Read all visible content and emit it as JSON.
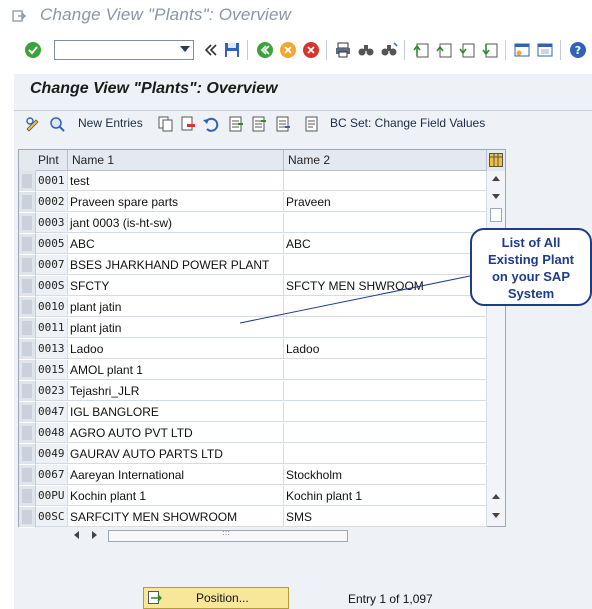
{
  "window": {
    "title": "Change View \"Plants\": Overview"
  },
  "screen": {
    "heading": "Change View \"Plants\": Overview"
  },
  "toolbar": {
    "new_entries": "New Entries",
    "bc_set": "BC Set: Change Field Values"
  },
  "table": {
    "headers": {
      "plnt": "Plnt",
      "name1": "Name 1",
      "name2": "Name 2"
    },
    "rows": [
      {
        "plnt": "0001",
        "name1": "test",
        "name2": ""
      },
      {
        "plnt": "0002",
        "name1": "Praveen spare parts",
        "name2": "Praveen"
      },
      {
        "plnt": "0003",
        "name1": "jant 0003 (is-ht-sw)",
        "name2": ""
      },
      {
        "plnt": "0005",
        "name1": "ABC",
        "name2": "ABC"
      },
      {
        "plnt": "0007",
        "name1": "BSES JHARKHAND POWER PLANT",
        "name2": ""
      },
      {
        "plnt": "000S",
        "name1": "SFCTY",
        "name2": "SFCTY MEN SHWROOM"
      },
      {
        "plnt": "0010",
        "name1": "plant jatin",
        "name2": ""
      },
      {
        "plnt": "0011",
        "name1": "plant jatin",
        "name2": ""
      },
      {
        "plnt": "0013",
        "name1": "Ladoo",
        "name2": "Ladoo"
      },
      {
        "plnt": "0015",
        "name1": "AMOL plant 1",
        "name2": ""
      },
      {
        "plnt": "0023",
        "name1": "Tejashri_JLR",
        "name2": ""
      },
      {
        "plnt": "0047",
        "name1": "IGL BANGLORE",
        "name2": ""
      },
      {
        "plnt": "0048",
        "name1": "AGRO AUTO PVT LTD",
        "name2": ""
      },
      {
        "plnt": "0049",
        "name1": "GAURAV AUTO PARTS LTD",
        "name2": ""
      },
      {
        "plnt": "0067",
        "name1": "Aareyan International",
        "name2": "Stockholm"
      },
      {
        "plnt": "00PU",
        "name1": "Kochin plant 1",
        "name2": "Kochin plant 1"
      },
      {
        "plnt": "00SC",
        "name1": "SARFCITY MEN SHOWROOM",
        "name2": "SMS"
      }
    ]
  },
  "callout": {
    "line1": "List of All",
    "line2": "Existing Plant",
    "line3": "on your SAP",
    "line4": "System"
  },
  "footer": {
    "position_button": "Position...",
    "entry_info": "Entry 1 of 1,097"
  },
  "colors": {
    "accent": "#1f3c8c",
    "position_button_bg": "#f7e79a",
    "title_text": "#8a95a4"
  }
}
